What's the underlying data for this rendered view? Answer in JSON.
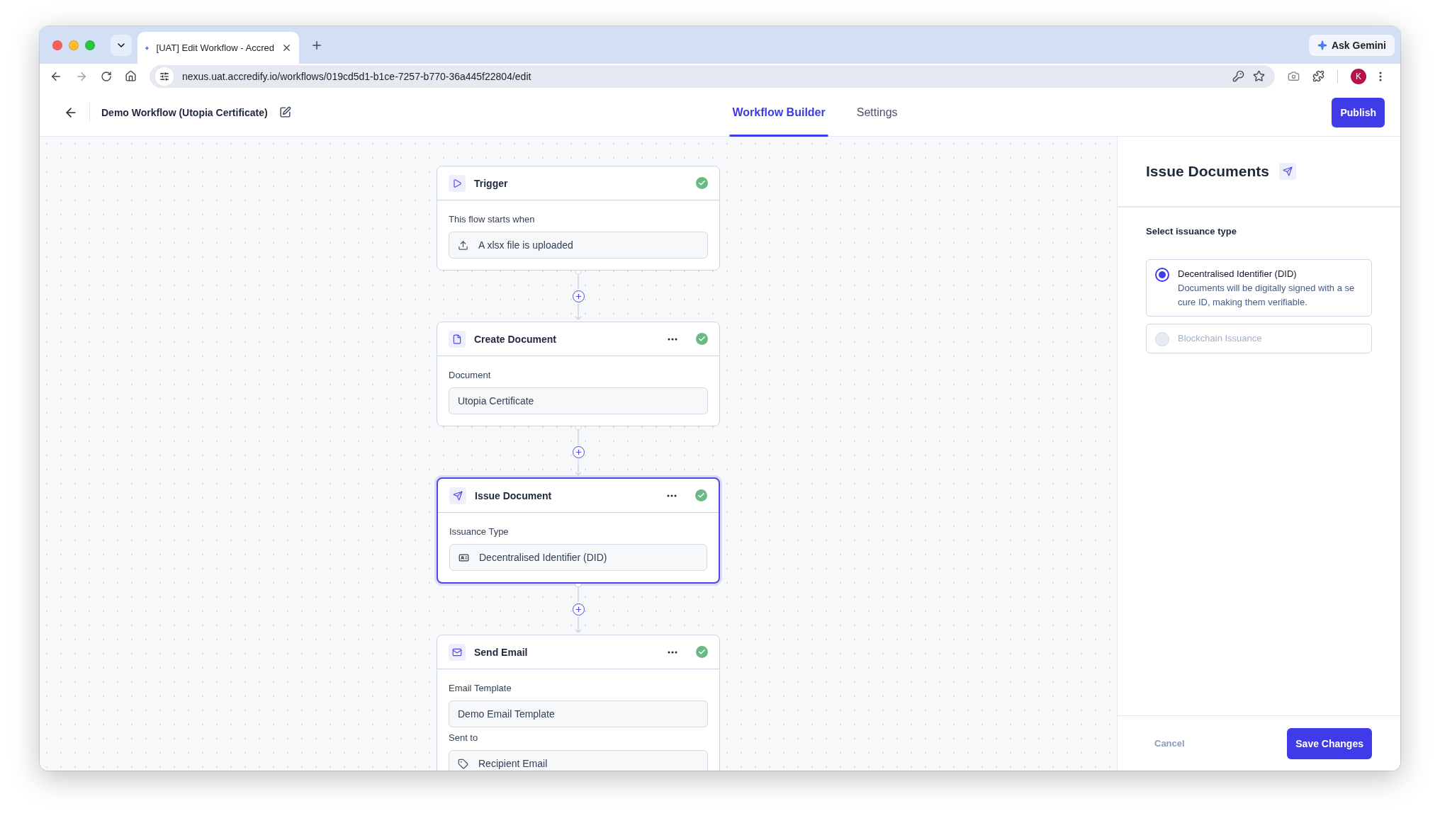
{
  "browser": {
    "tab_title": "[UAT] Edit Workflow - Accred",
    "url": "nexus.uat.accredify.io/workflows/019cd5d1-b1ce-7257-b770-36a445f22804/edit",
    "assistant": "Ask Gemini",
    "profile": "K"
  },
  "header": {
    "title": "Demo Workflow (Utopia Certificate)",
    "tabs": [
      {
        "label": "Workflow Builder",
        "selected": true
      },
      {
        "label": "Settings",
        "selected": false
      }
    ],
    "publish": "Publish"
  },
  "nodes": [
    {
      "kind": "trigger",
      "title": "Trigger",
      "menu": false,
      "complete": true,
      "selected": false,
      "fields": [
        {
          "label": "This flow starts when",
          "value": "A xlsx file is uploaded",
          "kind": "upload"
        }
      ]
    },
    {
      "kind": "document",
      "title": "Create Document",
      "menu": true,
      "complete": true,
      "selected": false,
      "fields": [
        {
          "label": "Document",
          "value": "Utopia Certificate",
          "kind": "plain"
        }
      ]
    },
    {
      "kind": "issue",
      "title": "Issue Document",
      "menu": true,
      "complete": true,
      "selected": true,
      "fields": [
        {
          "label": "Issuance Type",
          "value": "Decentralised Identifier (DID)",
          "kind": "id-card"
        }
      ]
    },
    {
      "kind": "email",
      "title": "Send Email",
      "menu": true,
      "complete": true,
      "selected": false,
      "fields": [
        {
          "label": "Email Template",
          "value": "Demo Email Template",
          "kind": "plain"
        },
        {
          "label": "Sent to",
          "value": "Recipient Email",
          "kind": "tag"
        }
      ]
    }
  ],
  "panel": {
    "title": "Issue Documents",
    "section": "Select issuance type",
    "options": [
      {
        "title": "Decentralised Identifier (DID)",
        "description": "Documents will be digitally signed with a secure ID, making them verifiable.",
        "selected": true,
        "disabled": false
      },
      {
        "title": "Blockchain Issuance",
        "selected": false,
        "disabled": true
      }
    ],
    "cancel": "Cancel",
    "save": "Save Changes"
  }
}
